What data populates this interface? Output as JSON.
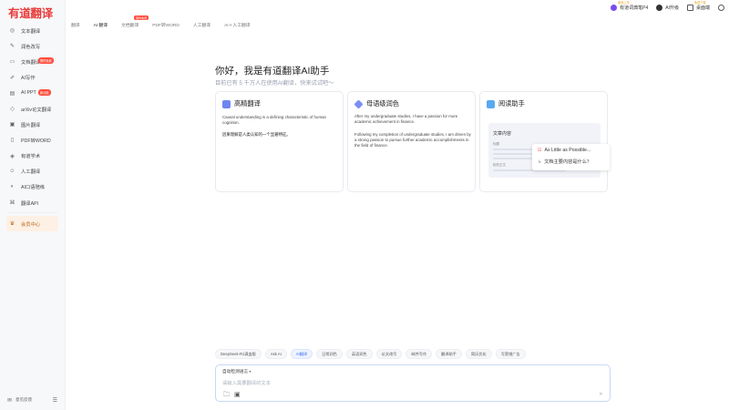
{
  "app": {
    "logo": "有道翻译"
  },
  "sidebar": {
    "items": [
      {
        "label": "文本翻译",
        "icon": "text-translate-icon",
        "badge": ""
      },
      {
        "label": "润色改写",
        "icon": "polish-icon",
        "badge": ""
      },
      {
        "label": "文档翻译",
        "icon": "document-icon",
        "badge": "限时免费"
      },
      {
        "label": "AI写作",
        "icon": "ai-write-icon",
        "badge": ""
      },
      {
        "label": "AI PPT",
        "icon": "ppt-icon",
        "badge": "新功能"
      },
      {
        "label": "arXiv论文翻译",
        "icon": "arxiv-icon",
        "badge": ""
      },
      {
        "label": "图片翻译",
        "icon": "image-icon",
        "badge": ""
      },
      {
        "label": "PDF转WORD",
        "icon": "pdf-icon",
        "badge": ""
      },
      {
        "label": "有道学术",
        "icon": "academic-icon",
        "badge": ""
      },
      {
        "label": "人工翻译",
        "icon": "human-icon",
        "badge": ""
      },
      {
        "label": "AI口语陪练",
        "icon": "speak-icon",
        "badge": ""
      },
      {
        "label": "翻译API",
        "icon": "api-icon",
        "badge": ""
      }
    ],
    "active_item": {
      "label": "会员中心",
      "icon": "vip-icon"
    },
    "footer": {
      "feedback_label": "意见反馈"
    }
  },
  "tabs": [
    {
      "label": "翻译",
      "active": false,
      "badge": ""
    },
    {
      "label": "AI 翻译",
      "active": true,
      "badge": ""
    },
    {
      "label": "文档翻译",
      "active": false,
      "badge": "限时免费"
    },
    {
      "label": "PDF转WORD",
      "active": false,
      "badge": ""
    },
    {
      "label": "人工翻译",
      "active": false,
      "badge": ""
    },
    {
      "label": "AI＋人工翻译",
      "active": false,
      "badge": ""
    }
  ],
  "topright": {
    "dictpen": {
      "label": "有道词典笔P4",
      "tag": "新品上市"
    },
    "software": {
      "label": "AI升级"
    },
    "desktop": {
      "label": "桌面端",
      "tag": "免费下载"
    }
  },
  "greeting": {
    "title": "你好，我是有道翻译AI助手",
    "subtitle": "目前已有 5 千万人在使用AI翻译，快来试试吧～"
  },
  "cards": {
    "card1": {
      "title": "高精翻译",
      "en": "Causal understanding is a defining characteristic of human cognition.",
      "cn": "因果理解是人类认知的一个显著特征。"
    },
    "card2": {
      "title": "母语级润色",
      "before": "After my undergraduate studies, I have a passion for more academic achievement in finance.",
      "after": "Following my completion of undergraduate studies, I am driven by a strong passion to pursue further academic accomplishments in the field of finance."
    },
    "card3": {
      "title": "阅读助手",
      "doc_title": "文章内容",
      "label1": "标题",
      "label2": "相关正文",
      "q1": "As Little as Possible...",
      "q2": "文档主要内容是什么？"
    }
  },
  "chips": [
    {
      "label": "DeepSeek-R1满血版",
      "active": false
    },
    {
      "label": "Ask AI",
      "active": false
    },
    {
      "label": "AI翻译",
      "active": true
    },
    {
      "label": "日常润色",
      "active": false
    },
    {
      "label": "英语润色",
      "active": false
    },
    {
      "label": "论文改写",
      "active": false
    },
    {
      "label": "邮件写作",
      "active": false
    },
    {
      "label": "翻译助手",
      "active": false
    },
    {
      "label": "简历优化",
      "active": false
    },
    {
      "label": "写营销广告",
      "active": false
    }
  ],
  "input": {
    "lang_label": "自动检测语言",
    "placeholder": "请输入需要翻译的文本"
  },
  "colors": {
    "brand": "#e83a38",
    "accent": "#3a6df0",
    "vip": "#b8661e"
  }
}
